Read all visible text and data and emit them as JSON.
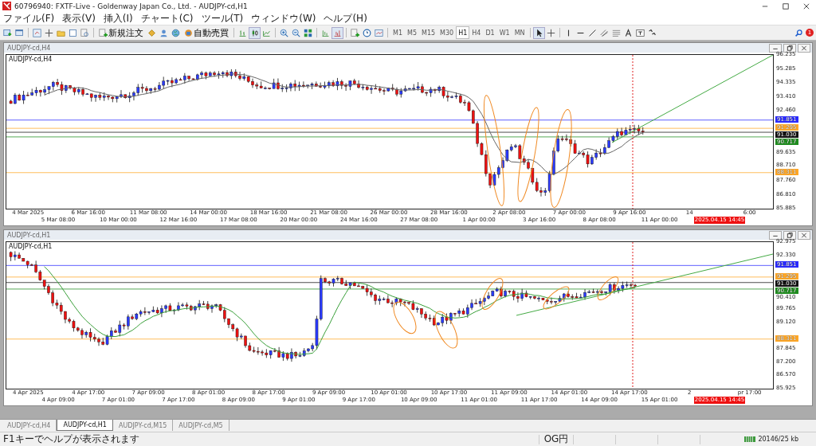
{
  "window": {
    "title": "60796940: FXTF-Live - Goldenway Japan Co., Ltd. - AUDJPY-cd,H1"
  },
  "menu": [
    "ファイル(F)",
    "表示(V)",
    "挿入(I)",
    "チャート(C)",
    "ツール(T)",
    "ウィンドウ(W)",
    "ヘルプ(H)"
  ],
  "toolbar": {
    "buttons": [
      "新規注文",
      "自動売買"
    ],
    "timeframes": [
      {
        "label": "M1",
        "selected": false
      },
      {
        "label": "M5",
        "selected": false
      },
      {
        "label": "M15",
        "selected": false
      },
      {
        "label": "M30",
        "selected": false
      },
      {
        "label": "H1",
        "selected": true
      },
      {
        "label": "H4",
        "selected": false
      },
      {
        "label": "D1",
        "selected": false
      },
      {
        "label": "W1",
        "selected": false
      },
      {
        "label": "MN",
        "selected": false
      }
    ],
    "badge": "1"
  },
  "charts": [
    {
      "window_title": "AUDJPY-cd,H4",
      "label": "AUDJPY-cd,H4",
      "yticks": [
        "96.235",
        "95.285",
        "94.335",
        "93.410",
        "92.460",
        "89.635",
        "88.710",
        "87.760",
        "86.810",
        "85.885"
      ],
      "price_tags": [
        {
          "text": "91.851",
          "color": "#2b2bff"
        },
        {
          "text": "91.295",
          "color": "#ffa726"
        },
        {
          "text": "91.030",
          "color": "#111111"
        },
        {
          "text": "90.717",
          "color": "#1e8c1e"
        },
        {
          "text": "88.311",
          "color": "#ffa726"
        }
      ],
      "xticks": [
        {
          "text": "4 Mar 2025",
          "kind": "tick"
        },
        {
          "text": "5 Mar 08:00",
          "kind": "tick"
        },
        {
          "text": "6 Mar 16:00",
          "kind": "tick"
        },
        {
          "text": "10 Mar 00:00",
          "kind": "tick"
        },
        {
          "text": "11 Mar 08:00",
          "kind": "tick"
        },
        {
          "text": "12 Mar 16:00",
          "kind": "tick"
        },
        {
          "text": "14 Mar 00:00",
          "kind": "tick"
        },
        {
          "text": "17 Mar 08:00",
          "kind": "tick"
        },
        {
          "text": "18 Mar 16:00",
          "kind": "tick"
        },
        {
          "text": "20 Mar 00:00",
          "kind": "tick"
        },
        {
          "text": "21 Mar 08:00",
          "kind": "tick"
        },
        {
          "text": "24 Mar 16:00",
          "kind": "tick"
        },
        {
          "text": "26 Mar 00:00",
          "kind": "tick"
        },
        {
          "text": "27 Mar 08:00",
          "kind": "tick"
        },
        {
          "text": "28 Mar 16:00",
          "kind": "tick"
        },
        {
          "text": "1 Apr 00:00",
          "kind": "tick"
        },
        {
          "text": "2 Apr 08:00",
          "kind": "tick"
        },
        {
          "text": "3 Apr 16:00",
          "kind": "tick"
        },
        {
          "text": "7 Apr 00:00",
          "kind": "tick"
        },
        {
          "text": "8 Apr 08:00",
          "kind": "tick"
        },
        {
          "text": "9 Apr 16:00",
          "kind": "tick"
        },
        {
          "text": "11 Apr 00:00",
          "kind": "tick"
        },
        {
          "text": "14",
          "kind": "tick"
        },
        {
          "text": "2025.04.15 14:45",
          "kind": "cursor"
        },
        {
          "text": "6:00",
          "kind": "tick"
        }
      ]
    },
    {
      "window_title": "AUDJPY-cd,H1",
      "label": "AUDJPY-cd,H1",
      "yticks": [
        "92.975",
        "92.330",
        "90.410",
        "89.765",
        "89.120",
        "87.845",
        "87.200",
        "86.570",
        "85.925"
      ],
      "price_tags": [
        {
          "text": "91.851",
          "color": "#2b2bff"
        },
        {
          "text": "91.295",
          "color": "#ffa726"
        },
        {
          "text": "91.030",
          "color": "#111111"
        },
        {
          "text": "90.717",
          "color": "#1e8c1e"
        },
        {
          "text": "88.311",
          "color": "#ffa726"
        }
      ],
      "xticks": [
        {
          "text": "4 Apr 2025",
          "kind": "tick"
        },
        {
          "text": "4 Apr 09:00",
          "kind": "tick"
        },
        {
          "text": "4 Apr 17:00",
          "kind": "tick"
        },
        {
          "text": "7 Apr 01:00",
          "kind": "tick"
        },
        {
          "text": "7 Apr 09:00",
          "kind": "tick"
        },
        {
          "text": "7 Apr 17:00",
          "kind": "tick"
        },
        {
          "text": "8 Apr 01:00",
          "kind": "tick"
        },
        {
          "text": "8 Apr 09:00",
          "kind": "tick"
        },
        {
          "text": "8 Apr 17:00",
          "kind": "tick"
        },
        {
          "text": "9 Apr 01:00",
          "kind": "tick"
        },
        {
          "text": "9 Apr 09:00",
          "kind": "tick"
        },
        {
          "text": "9 Apr 17:00",
          "kind": "tick"
        },
        {
          "text": "10 Apr 01:00",
          "kind": "tick"
        },
        {
          "text": "10 Apr 09:00",
          "kind": "tick"
        },
        {
          "text": "10 Apr 17:00",
          "kind": "tick"
        },
        {
          "text": "11 Apr 01:00",
          "kind": "tick"
        },
        {
          "text": "11 Apr 09:00",
          "kind": "tick"
        },
        {
          "text": "11 Apr 17:00",
          "kind": "tick"
        },
        {
          "text": "14 Apr 01:00",
          "kind": "tick"
        },
        {
          "text": "14 Apr 09:00",
          "kind": "tick"
        },
        {
          "text": "14 Apr 17:00",
          "kind": "tick"
        },
        {
          "text": "15 Apr 01:00",
          "kind": "tick"
        },
        {
          "text": "2",
          "kind": "tick"
        },
        {
          "text": "2025.04.15 14:45",
          "kind": "cursor"
        },
        {
          "text": "pr 17:00",
          "kind": "tick"
        }
      ]
    }
  ],
  "tabs": [
    {
      "label": "AUDJPY-cd,H4",
      "selected": false
    },
    {
      "label": "AUDJPY-cd,H1",
      "selected": true
    },
    {
      "label": "AUDJPY-cd,M15",
      "selected": false
    },
    {
      "label": "AUDJPY-cd,M5",
      "selected": false
    }
  ],
  "status_bar": {
    "help": "F1キーでヘルプが表示されます",
    "profile": "OG円",
    "traffic": "20146/25 kb"
  }
}
